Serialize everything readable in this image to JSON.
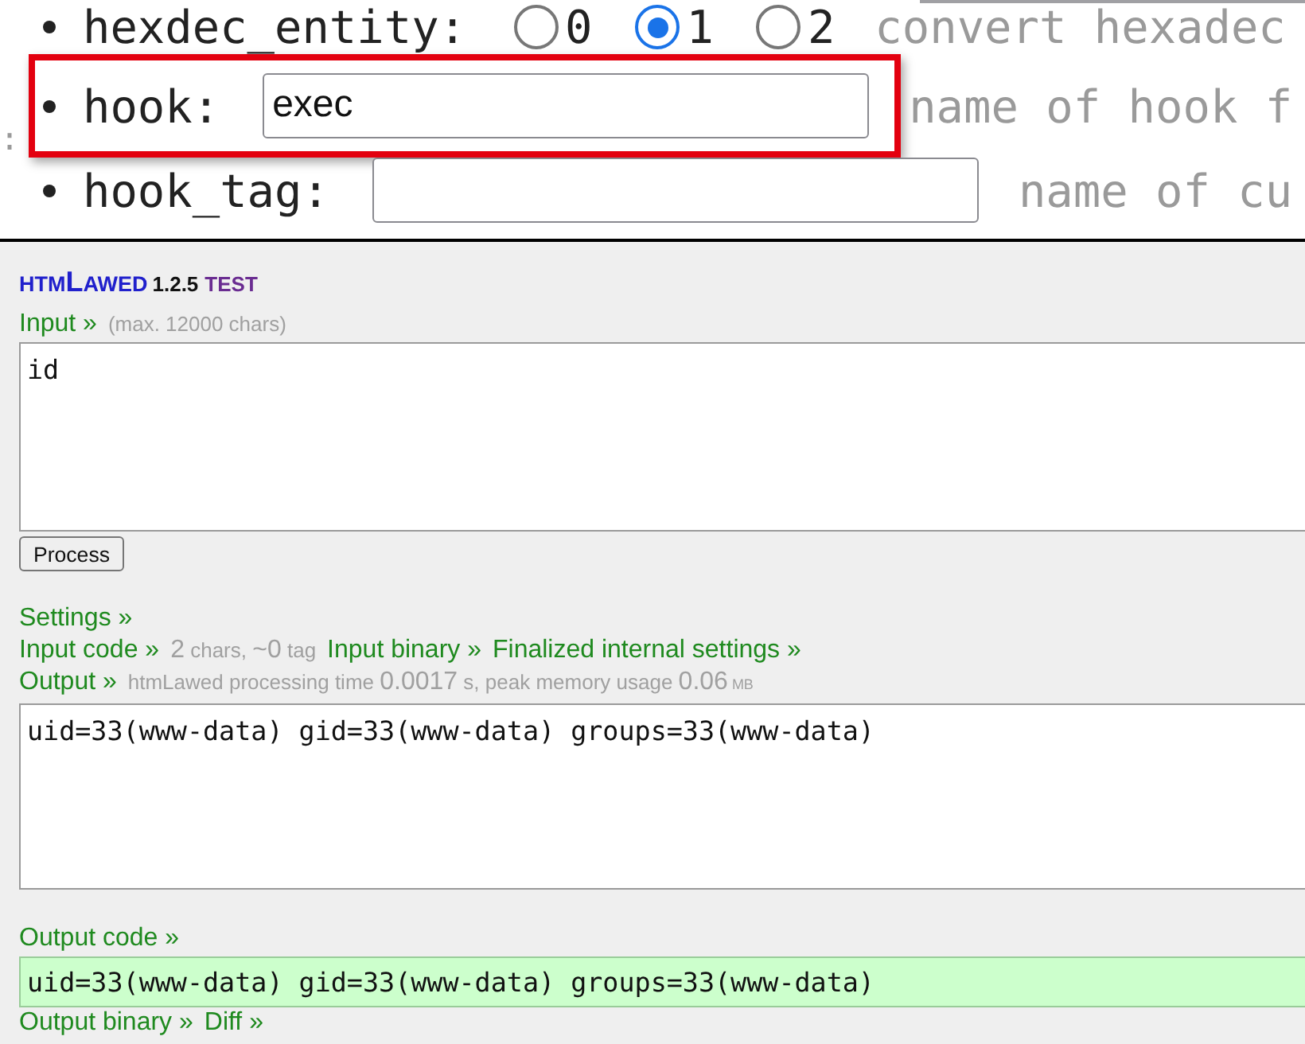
{
  "zoomed_form": {
    "edge_fragment": ":",
    "fields": [
      {
        "kind": "radio",
        "label": "hexdec_entity:",
        "options": [
          {
            "label": "0",
            "selected": false
          },
          {
            "label": "1",
            "selected": true
          },
          {
            "label": "2",
            "selected": false
          }
        ],
        "description": "convert hexadec",
        "highlighted": false
      },
      {
        "kind": "text",
        "label": "hook:",
        "value": "exec",
        "description": "name of hook f",
        "highlighted": true
      },
      {
        "kind": "text",
        "label": "hook_tag:",
        "description": "name of cu",
        "highlighted": false
      }
    ]
  },
  "htmlawed": {
    "title": {
      "logo_parts": [
        {
          "text": "HTM",
          "kind": "small"
        },
        {
          "text": "L",
          "kind": "large"
        },
        {
          "text": "AWED",
          "kind": "small"
        }
      ],
      "version": "1.2.5",
      "badge": "TEST"
    },
    "input": {
      "link": "Input »",
      "hint": "(max. 12000 chars)",
      "value": "id"
    },
    "process_button": "Process",
    "rows": [
      {
        "items": [
          {
            "kind": "link",
            "text": "Settings »"
          }
        ]
      },
      {
        "items": [
          {
            "kind": "link",
            "text": "Input code »"
          },
          {
            "kind": "stats",
            "parts": [
              {
                "kind": "number",
                "text": "2"
              },
              {
                "kind": "text",
                "text": " chars, "
              },
              {
                "kind": "number",
                "text": "~0"
              },
              {
                "kind": "text",
                "text": " tag"
              }
            ]
          },
          {
            "kind": "link",
            "text": "Input binary »"
          },
          {
            "kind": "link",
            "text": "Finalized internal settings »"
          }
        ]
      },
      {
        "items": [
          {
            "kind": "link",
            "text": "Output »"
          },
          {
            "kind": "stats",
            "parts": [
              {
                "kind": "text",
                "text": "htmLawed processing time "
              },
              {
                "kind": "number",
                "text": "0.0017"
              },
              {
                "kind": "text",
                "text": " s, peak memory usage "
              },
              {
                "kind": "number",
                "text": "0.06"
              },
              {
                "kind": "unit",
                "text": " MB"
              }
            ]
          }
        ]
      }
    ],
    "output": {
      "value": "uid=33(www-data) gid=33(www-data) groups=33(www-data)"
    },
    "output_code": {
      "link": "Output code »",
      "value": "uid=33(www-data) gid=33(www-data) groups=33(www-data)"
    },
    "footer_links": [
      "Output binary »",
      "Diff »"
    ]
  }
}
